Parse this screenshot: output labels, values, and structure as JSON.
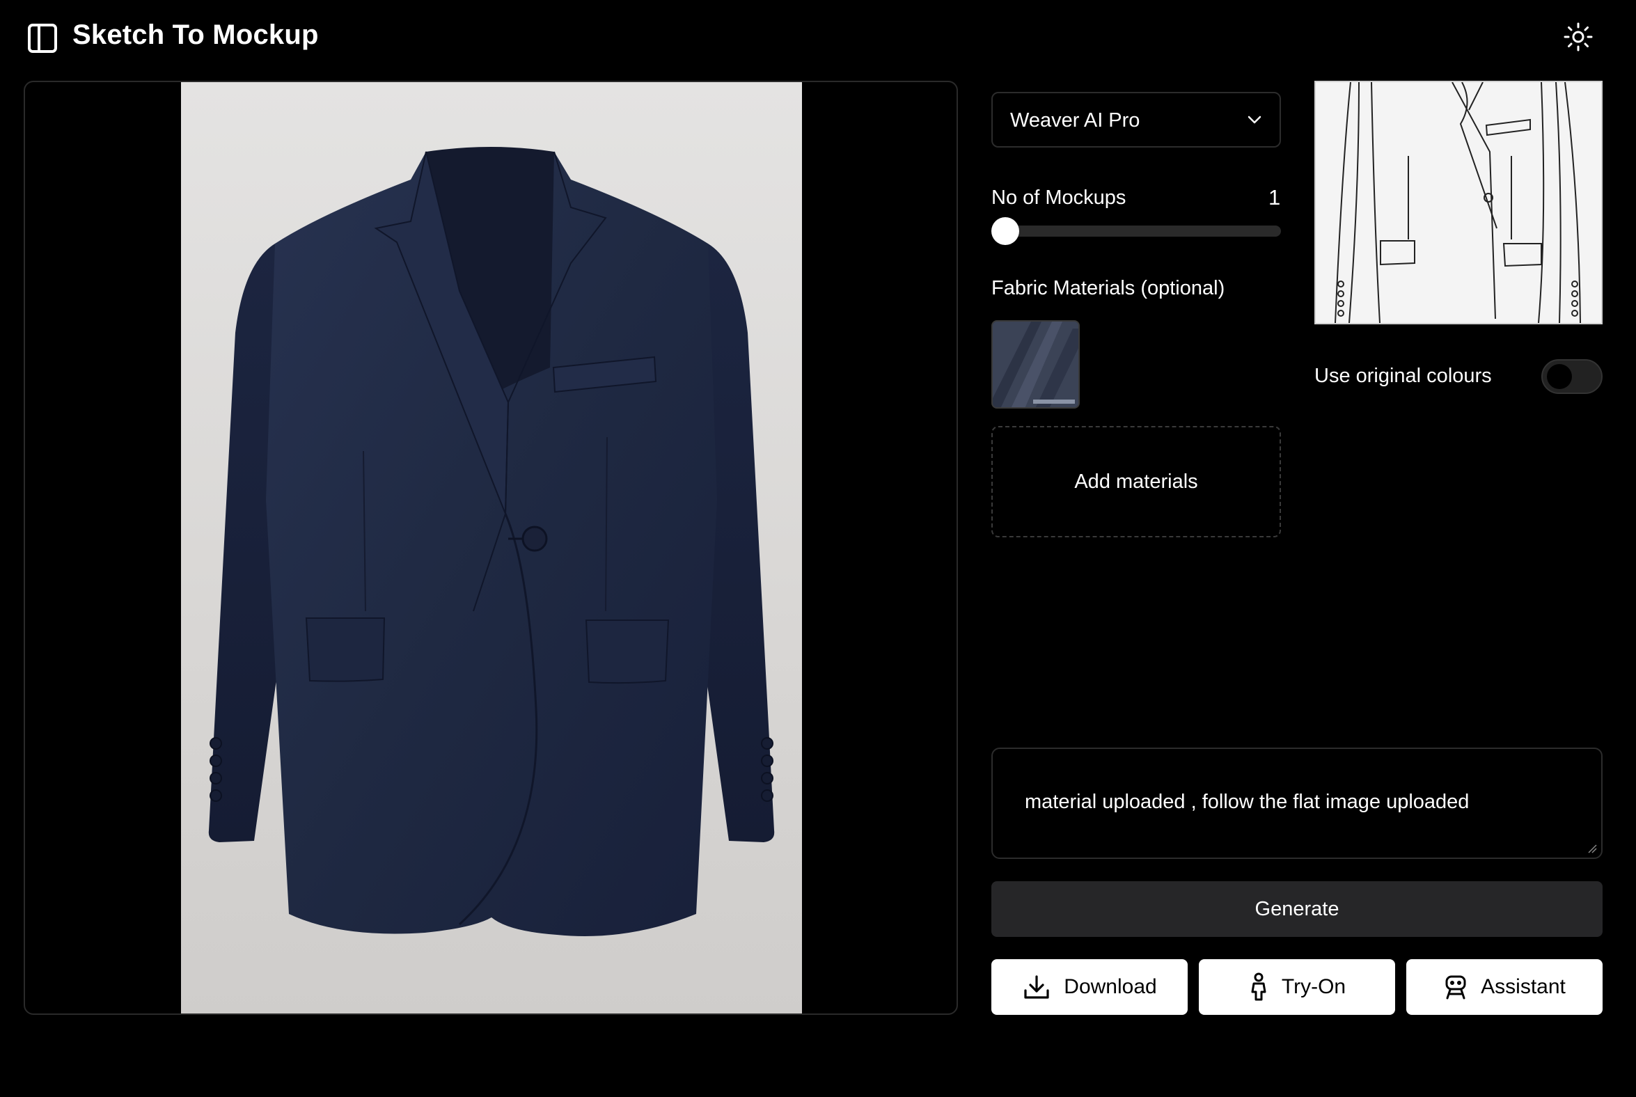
{
  "header": {
    "title": "Sketch To Mockup",
    "sidebar_toggle_icon": "sidebar-panel-icon",
    "theme_toggle_icon": "sun-icon"
  },
  "preview": {
    "image": "navy-blazer-mockup",
    "background_color": "#000000",
    "garment_color": "#1f2942"
  },
  "controls": {
    "model_select": {
      "value": "Weaver AI Pro",
      "icon": "chevron-down-icon"
    },
    "mockups": {
      "label": "No of Mockups",
      "value": "1",
      "slider_fraction": 0
    },
    "fabric": {
      "label": "Fabric Materials (optional)",
      "add_label": "Add materials",
      "material_color": "#3b4356"
    },
    "sketch": {
      "image": "blazer-flat-sketch"
    },
    "original_colours": {
      "label": "Use original colours",
      "enabled": false
    },
    "prompt": {
      "value": "material uploaded , follow the flat image uploaded"
    },
    "generate_label": "Generate",
    "actions": {
      "download_label": "Download",
      "tryon_label": "Try-On",
      "assistant_label": "Assistant"
    }
  },
  "colors": {
    "background": "#000000",
    "panel_border": "#2c2c2c",
    "generate_bg": "#262628",
    "action_bg": "#ffffff"
  }
}
